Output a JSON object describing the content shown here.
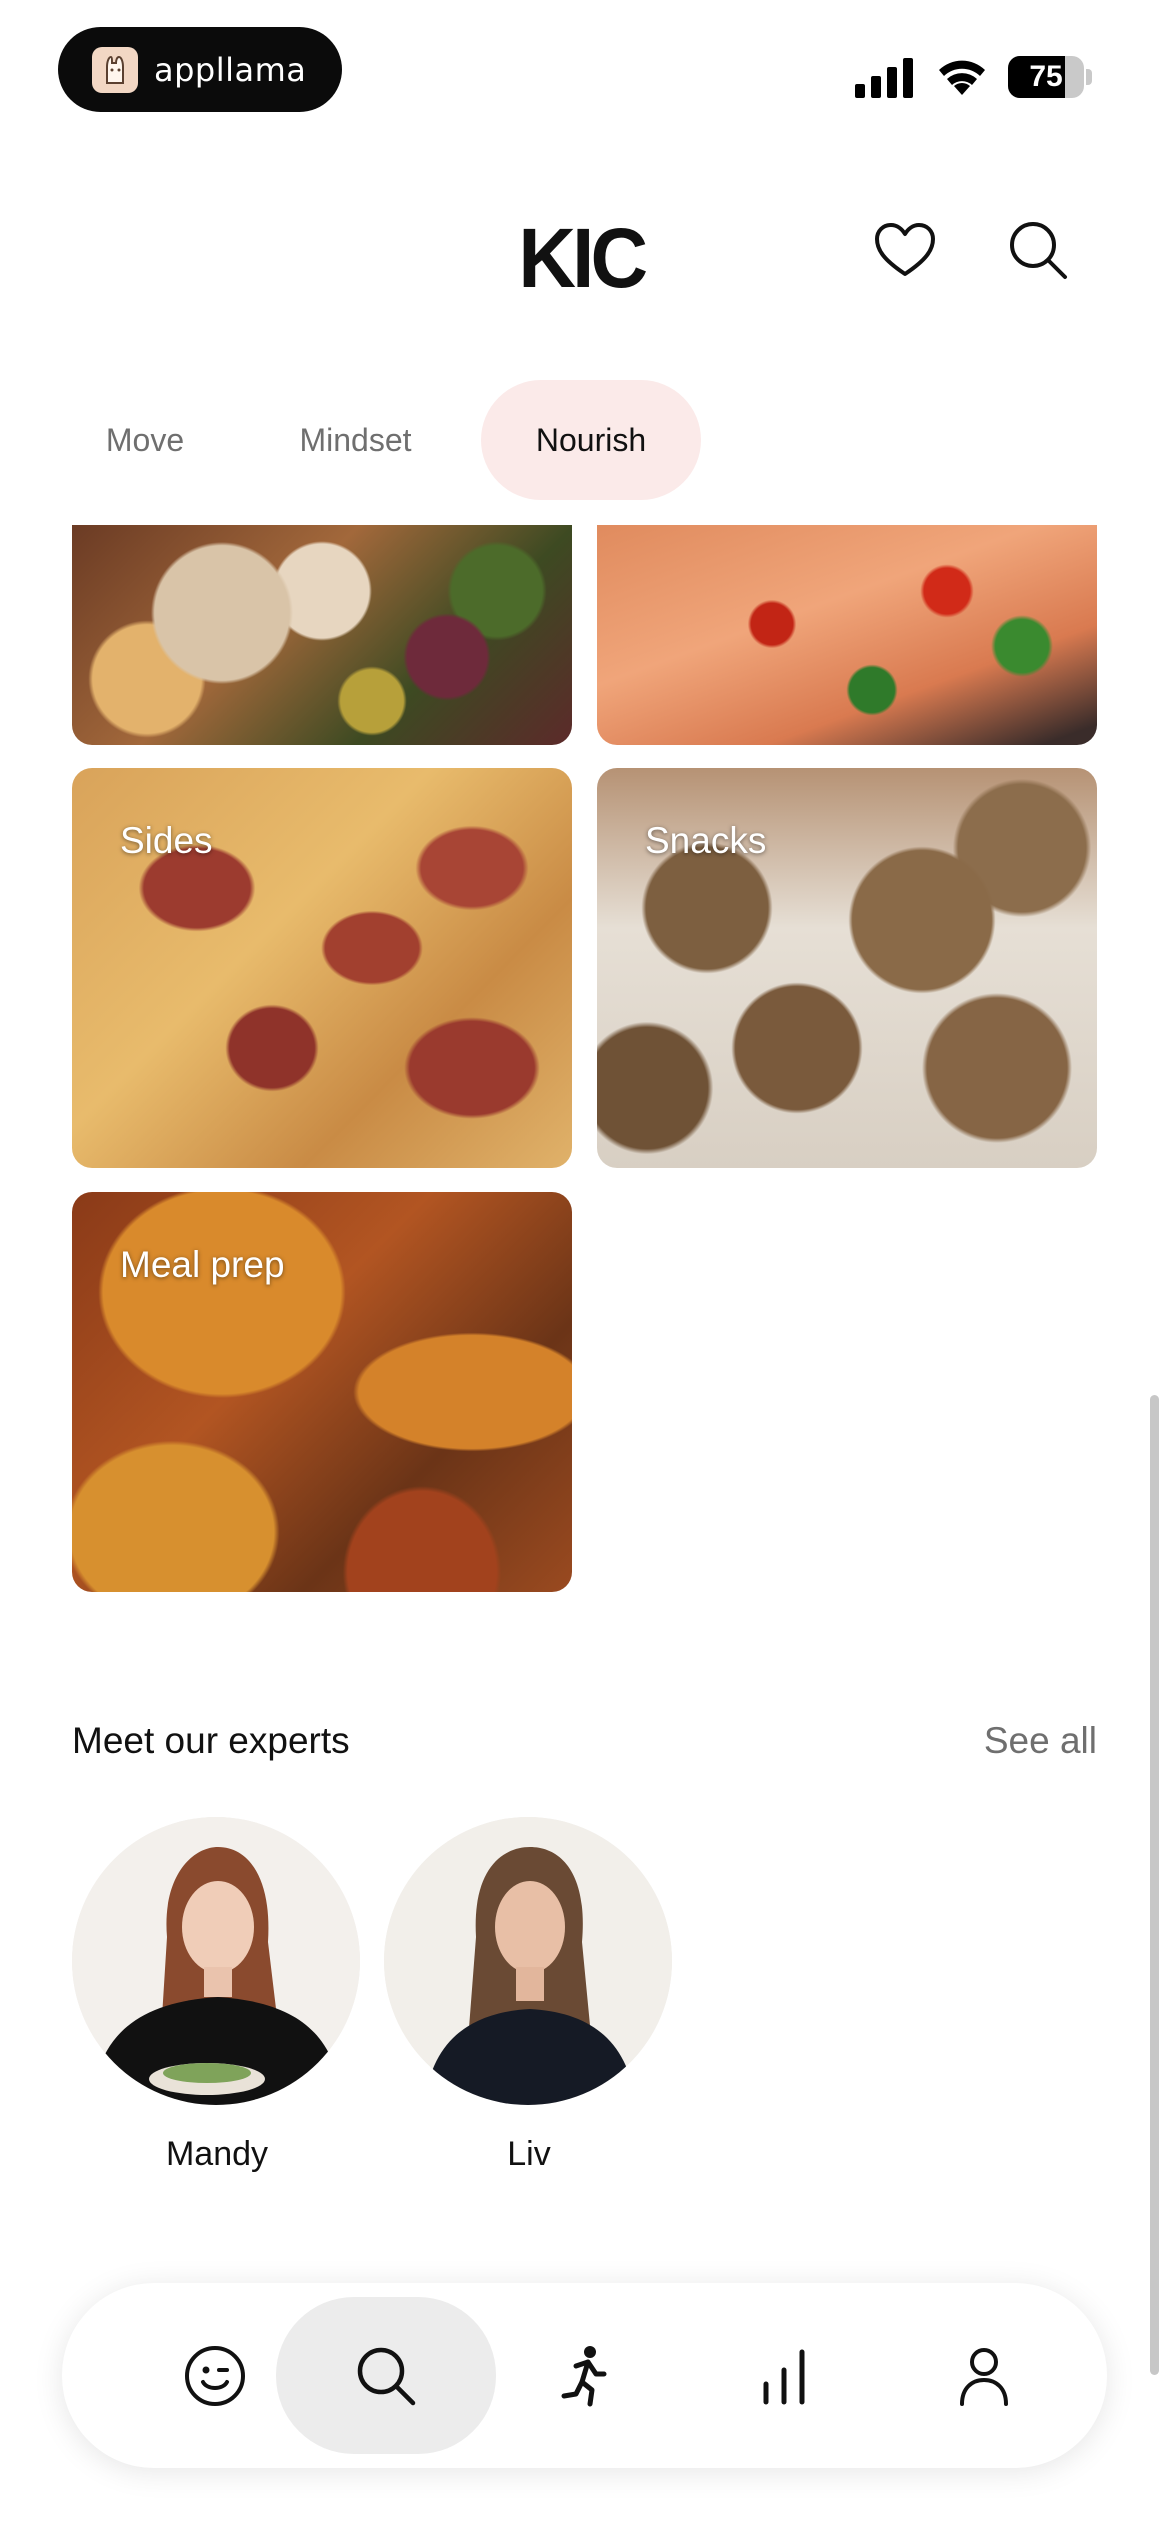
{
  "status_bar": {
    "app_label": "appllama",
    "battery_percent": "75",
    "battery_level": 0.75,
    "icons": [
      "signal-icon",
      "wifi-icon",
      "battery-icon"
    ]
  },
  "header": {
    "brand": "KIC",
    "icons": [
      "heart-icon",
      "search-icon"
    ]
  },
  "tabs": [
    {
      "label": "Move",
      "active": false
    },
    {
      "label": "Mindset",
      "active": false
    },
    {
      "label": "Nourish",
      "active": true
    }
  ],
  "categories": [
    {
      "title": ""
    },
    {
      "title": ""
    },
    {
      "title": "Sides"
    },
    {
      "title": "Snacks"
    },
    {
      "title": "Meal prep"
    }
  ],
  "experts_section": {
    "title": "Meet our experts",
    "see_all": "See all",
    "experts": [
      {
        "name": "Mandy"
      },
      {
        "name": "Liv"
      }
    ]
  },
  "bottom_nav": {
    "items": [
      {
        "icon": "smiley-icon",
        "active": false
      },
      {
        "icon": "search-icon",
        "active": true
      },
      {
        "icon": "running-person-icon",
        "active": false
      },
      {
        "icon": "bar-chart-icon",
        "active": false
      },
      {
        "icon": "profile-icon",
        "active": false
      }
    ]
  },
  "colors": {
    "active_tab_bg": "#fbeae9",
    "muted_text": "#6f6f6f",
    "nav_active_bg": "#ececec"
  }
}
